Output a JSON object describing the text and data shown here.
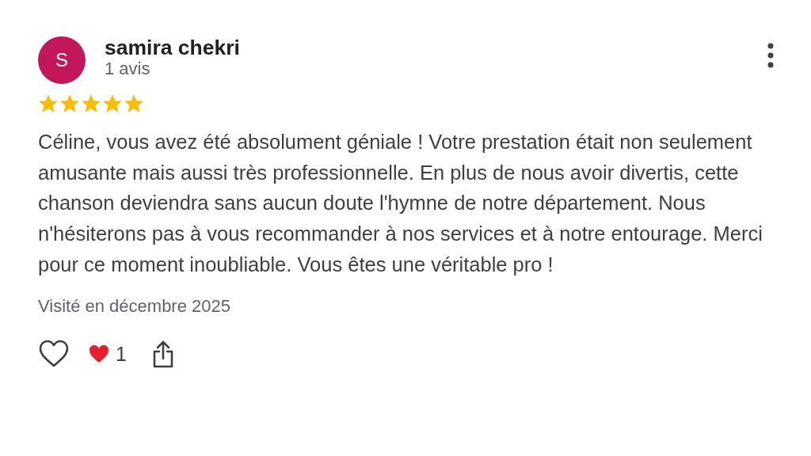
{
  "review": {
    "avatar_letter": "S",
    "author": "samira chekri",
    "review_count": "1 avis",
    "stars": 5,
    "text": "Céline, vous avez été absolument géniale ! Votre prestation était non seulement amusante mais aussi très professionnelle. En plus de nous avoir divertis, cette chanson deviendra sans aucun doute l'hymne de notre département. Nous n'hésiterons pas à vous recommander à nos services et à notre entourage. Merci pour ce moment inoubliable. Vous êtes une véritable pro !",
    "visit": "Visité en décembre 2025",
    "reaction_count": "1"
  }
}
